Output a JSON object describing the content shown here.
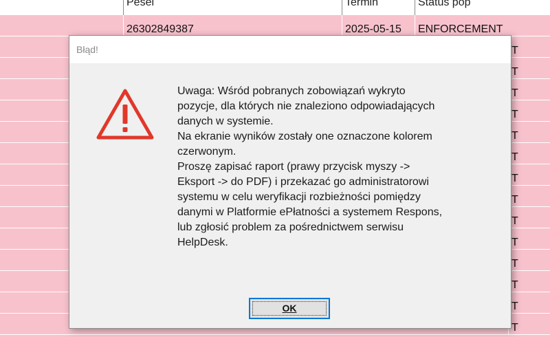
{
  "table": {
    "headers": [
      "Pesel",
      "Termin",
      "Status pop"
    ],
    "first_row": [
      "26302849387",
      "2025-05-15",
      "ENFORCEMENT"
    ],
    "row_fragments": [
      "T",
      "T",
      "T",
      "T",
      "T",
      "T",
      "T",
      "T",
      "T",
      "T",
      "T",
      "T",
      "T",
      "T"
    ],
    "row_color": "#f8c2cd"
  },
  "dialog": {
    "title": "Błąd!",
    "icon": "warning-triangle-icon",
    "icon_color": "#e0382b",
    "message_lines": [
      "Uwaga: Wśród pobranych zobowiązań wykryto",
      "pozycje, dla których nie znaleziono odpowiadających",
      "danych w systemie.",
      "Na ekranie wyników zostały one oznaczone kolorem",
      "czerwonym.",
      "Proszę zapisać raport (prawy przycisk myszy ->",
      "Eksport -> do PDF) i przekazać go administratorowi",
      "systemu w celu weryfikacji rozbieżności pomiędzy",
      "danymi w Platformie ePłatności a systemem Respons,",
      "lub zgłosić problem za pośrednictwem serwisu",
      "HelpDesk."
    ],
    "ok_label": "OK"
  }
}
